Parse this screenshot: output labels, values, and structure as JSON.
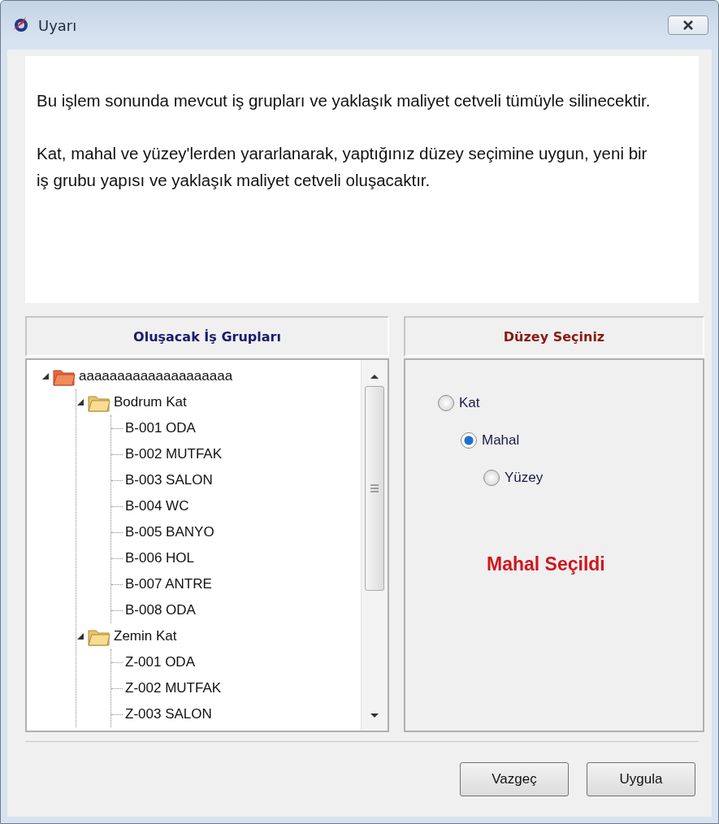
{
  "window": {
    "title": "Uyarı"
  },
  "message": [
    "Bu işlem sonunda mevcut iş grupları ve yaklaşık maliyet cetveli tümüyle silinecektir.",
    "Kat, mahal ve yüzey'lerden yararlanarak, yaptığınız düzey seçimine uygun, yeni bir iş grubu yapısı ve yaklaşık maliyet cetveli oluşacaktır."
  ],
  "tree_panel": {
    "title": "Oluşacak İş Grupları",
    "items": [
      {
        "label": "aaaaaaaaaaaaaaaaaaaa",
        "kind": "root",
        "expanded": true,
        "children": [
          {
            "label": "Bodrum Kat",
            "kind": "folder",
            "expanded": true,
            "children": [
              {
                "label": "B-001 ODA",
                "kind": "leaf"
              },
              {
                "label": "B-002 MUTFAK",
                "kind": "leaf"
              },
              {
                "label": "B-003 SALON",
                "kind": "leaf"
              },
              {
                "label": "B-004 WC",
                "kind": "leaf"
              },
              {
                "label": "B-005 BANYO",
                "kind": "leaf"
              },
              {
                "label": "B-006 HOL",
                "kind": "leaf"
              },
              {
                "label": "B-007 ANTRE",
                "kind": "leaf"
              },
              {
                "label": "B-008 ODA",
                "kind": "leaf"
              }
            ]
          },
          {
            "label": "Zemin Kat",
            "kind": "folder",
            "expanded": true,
            "children": [
              {
                "label": "Z-001 ODA",
                "kind": "leaf"
              },
              {
                "label": "Z-002 MUTFAK",
                "kind": "leaf"
              },
              {
                "label": "Z-003 SALON",
                "kind": "leaf"
              }
            ]
          }
        ]
      }
    ]
  },
  "level_panel": {
    "title": "Düzey Seçiniz",
    "options": [
      {
        "label": "Kat",
        "selected": false
      },
      {
        "label": "Mahal",
        "selected": true
      },
      {
        "label": "Yüzey",
        "selected": false
      }
    ],
    "status": "Mahal Seçildi"
  },
  "buttons": [
    "Vazgeç",
    "Uygula"
  ]
}
